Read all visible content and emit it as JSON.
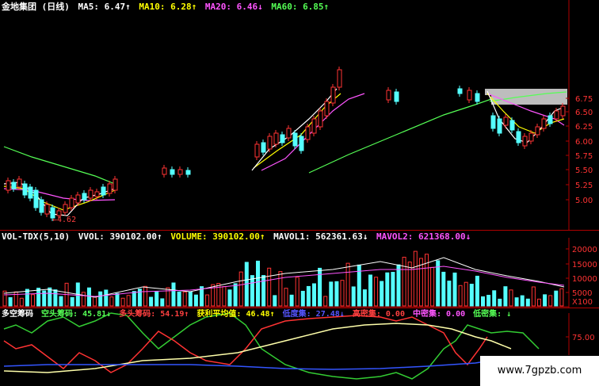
{
  "header": {
    "title": "金地集团 (日线)",
    "ma5": "MA5: 6.47↑",
    "ma10": "MA10: 6.28↑",
    "ma20": "MA20: 6.46↓",
    "ma60": "MA60: 6.85↑"
  },
  "price_axis": {
    "ticks": [
      "6.75",
      "6.50",
      "6.25",
      "6.00",
      "5.75",
      "5.50",
      "5.25",
      "5.00"
    ],
    "low_label": "←4.62"
  },
  "volume_header": {
    "indicator": "VOL-TDX(5,10)",
    "vvol": "VVOL: 390102.00↑",
    "volume": "VOLUME: 390102.00↑",
    "mavol1": "MAVOL1: 562361.63↓",
    "mavol2": "MAVOL2: 621368.00↓"
  },
  "volume_axis": {
    "ticks": [
      "20000",
      "15000",
      "10000",
      "5000"
    ],
    "unit": "X100"
  },
  "chip_header": {
    "title": "多空筹码",
    "short": "空头筹码: 45.81↓",
    "long": "多头筹码: 54.19↑",
    "avg": "获利平均值: 46.48↑",
    "f1": "低度集: 27.48↓",
    "f2": "高密集: 0.00",
    "f3": "中密集: 0.00",
    "f4": "低密集: ↓"
  },
  "chip_axis": {
    "ticks": [
      "75.00"
    ]
  },
  "watermark": "www.7gpzb.com",
  "colors": {
    "up": "#ff3333",
    "down": "#55ffff",
    "ma5": "#ffffff",
    "ma10": "#ffff00",
    "ma20": "#ff55ff",
    "ma60": "#55ff55"
  }
}
